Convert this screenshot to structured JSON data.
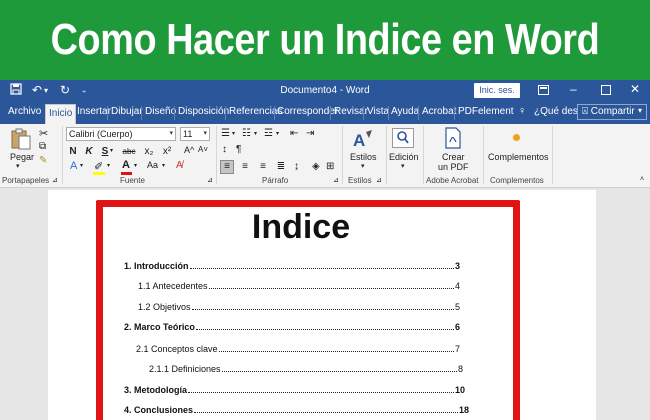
{
  "banner": {
    "title": "Como Hacer un Indice en Word"
  },
  "titlebar": {
    "doc_title": "Documento4  -  Word",
    "signin_label": "Inic. ses.",
    "save_icon": "save-icon",
    "undo_icon": "undo-icon",
    "redo_icon": "redo-icon"
  },
  "tabs": [
    {
      "label": "Archivo"
    },
    {
      "label": "Inicio"
    },
    {
      "label": "Insertar"
    },
    {
      "label": "Dibujar"
    },
    {
      "label": "Diseño"
    },
    {
      "label": "Disposición"
    },
    {
      "label": "Referencias"
    },
    {
      "label": "Corresponder"
    },
    {
      "label": "Revisar"
    },
    {
      "label": "Vista"
    },
    {
      "label": "Ayuda"
    },
    {
      "label": "Acrobat"
    },
    {
      "label": "PDFelement"
    }
  ],
  "tell_me": {
    "label": "¿Qué des"
  },
  "share": {
    "label": "Compartir"
  },
  "ribbon": {
    "clipboard": {
      "paste_label": "Pegar",
      "group_label": "Portapapeles"
    },
    "font": {
      "font_name": "Calibri (Cuerpo)",
      "font_size": "11",
      "group_label": "Fuente",
      "bold": "N",
      "italic": "K",
      "underline": "S",
      "strike": "abc",
      "sub": "x₂",
      "sup": "x²",
      "grow": "A^",
      "shrink": "A˅",
      "case": "Aa",
      "clear": "A"
    },
    "paragraph": {
      "group_label": "Párrafo",
      "pilcrow": "¶"
    },
    "styles": {
      "label": "Estilos",
      "group_label": "Estilos"
    },
    "editing": {
      "label": "Edición"
    },
    "acrobat": {
      "label_line1": "Crear",
      "label_line2": "un PDF",
      "group_label": "Adobe Acrobat"
    },
    "addins": {
      "label": "Complementos",
      "group_label": "Complementos"
    }
  },
  "document": {
    "toc_title": "Indice",
    "entries": [
      {
        "label": "1. Introducción",
        "page": "3",
        "bold": true
      },
      {
        "label": "1.1 Antecedentes",
        "page": "4",
        "bold": false
      },
      {
        "label": "1.2 Objetivos",
        "page": "5",
        "bold": false
      },
      {
        "label": "2. Marco Teórico",
        "page": "6",
        "bold": true
      },
      {
        "label": "2.1 Conceptos clave",
        "page": "7",
        "bold": false
      },
      {
        "label": "2.1.1 Definiciones",
        "page": "8",
        "bold": false
      },
      {
        "label": "3. Metodología",
        "page": "10",
        "bold": true
      },
      {
        "label": "4. Conclusiones",
        "page": "18",
        "bold": true
      }
    ]
  },
  "colors": {
    "banner": "#1e9a3a",
    "word_blue": "#2b579a",
    "frame_red": "#e01414"
  }
}
